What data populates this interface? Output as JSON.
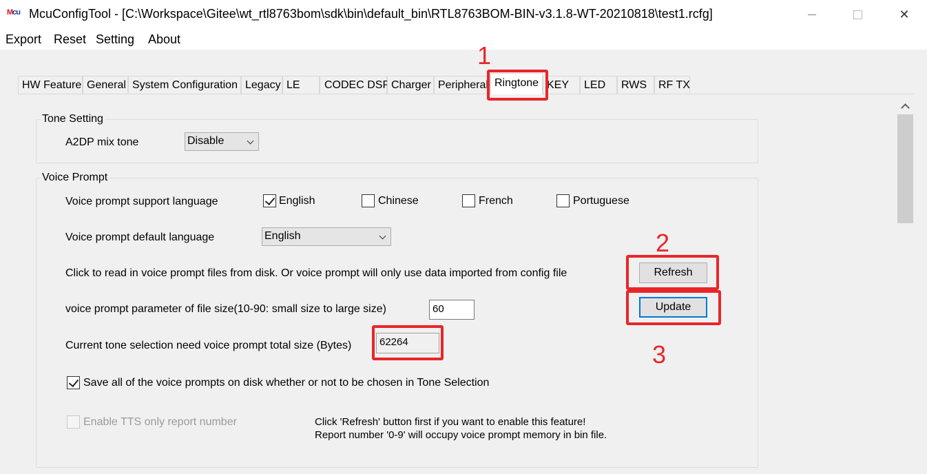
{
  "window": {
    "app_icon_text": "Mcu",
    "title": "McuConfigTool - [C:\\Workspace\\Gitee\\wt_rtl8763bom\\sdk\\bin\\default_bin\\RTL8763BOM-BIN-v3.1.8-WT-20210818\\test1.rcfg]",
    "close_glyph": "✕"
  },
  "menu": {
    "items": [
      "Export",
      "Reset",
      "Setting",
      "About"
    ]
  },
  "tabs": [
    "HW Feature",
    "General",
    "System Configuration",
    "Legacy",
    "LE",
    "CODEC DSP",
    "Charger",
    "Peripheral",
    "Ringtone",
    "KEY",
    "LED",
    "RWS",
    "RF TX"
  ],
  "active_tab": "Ringtone",
  "tone_setting": {
    "title": "Tone Setting",
    "a2dp_mix_label": "A2DP mix tone",
    "a2dp_mix_value": "Disable"
  },
  "voice_prompt": {
    "title": "Voice Prompt",
    "support_language_label": "Voice prompt support language",
    "languages": [
      {
        "name": "English",
        "checked": true
      },
      {
        "name": "Chinese",
        "checked": false
      },
      {
        "name": "French",
        "checked": false
      },
      {
        "name": "Portuguese",
        "checked": false
      }
    ],
    "default_language_label": "Voice prompt default language",
    "default_language_value": "English",
    "read_files_text": "Click to read in voice prompt files  from disk. Or voice prompt will only use data imported from config file",
    "refresh_label": "Refresh",
    "file_size_label": "voice prompt parameter of file size(10-90: small size to large size)",
    "file_size_value": "60",
    "update_label": "Update",
    "total_size_label": "Current tone selection need voice prompt total size (Bytes)",
    "total_size_value": "62264",
    "save_all_label": "Save all of the voice prompts on disk whether or not to be chosen in Tone Selection",
    "save_all_checked": true,
    "tts_label": "Enable TTS only report number",
    "tts_checked": false,
    "note_line1": "Click 'Refresh' button first if you want to enable this feature!",
    "note_line2": "Report number '0-9' will occupy voice prompt  memory in bin file."
  },
  "annotations": {
    "numbers": [
      "1",
      "2",
      "3"
    ],
    "color": "#e8262a"
  },
  "colors": {
    "accent": "#0078d7",
    "annotation": "#e8262a"
  }
}
